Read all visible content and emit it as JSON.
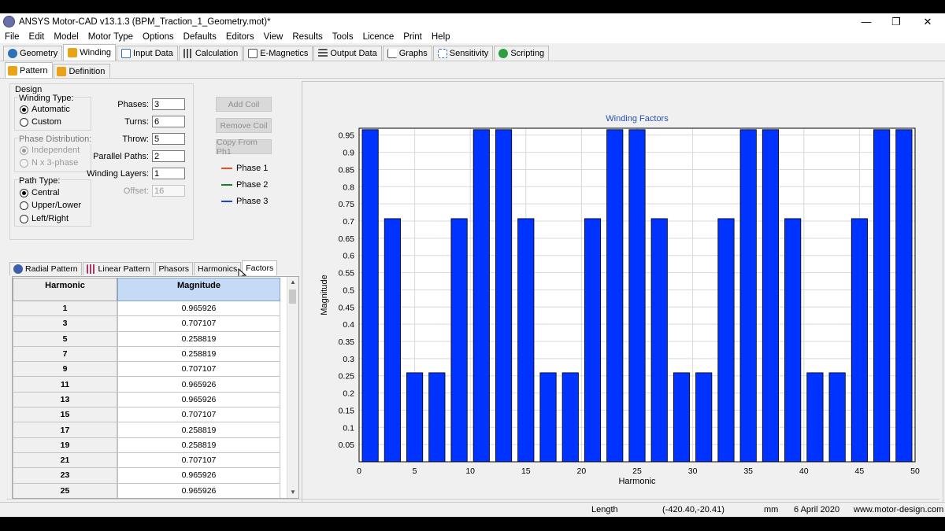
{
  "title": "ANSYS Motor-CAD v13.1.3 (BPM_Traction_1_Geometry.mot)*",
  "window_controls": {
    "minimize": "—",
    "restore": "❐",
    "close": "✕"
  },
  "menu": [
    "File",
    "Edit",
    "Model",
    "Motor Type",
    "Options",
    "Defaults",
    "Editors",
    "View",
    "Results",
    "Tools",
    "Licence",
    "Print",
    "Help"
  ],
  "main_tabs": [
    {
      "label": "Geometry",
      "icon": "geometry-icon",
      "color": "#2e6fb8"
    },
    {
      "label": "Winding",
      "icon": "winding-icon",
      "color": "#e8a318"
    },
    {
      "label": "Input Data",
      "icon": "input-data-icon",
      "color": "#3b6fa8"
    },
    {
      "label": "Calculation",
      "icon": "calculation-icon",
      "color": "#555555"
    },
    {
      "label": "E-Magnetics",
      "icon": "emagnetics-icon",
      "color": "#555555"
    },
    {
      "label": "Output Data",
      "icon": "output-data-icon",
      "color": "#555555"
    },
    {
      "label": "Graphs",
      "icon": "graphs-icon",
      "color": "#c0392b"
    },
    {
      "label": "Sensitivity",
      "icon": "sensitivity-icon",
      "color": "#3b6fa8"
    },
    {
      "label": "Scripting",
      "icon": "scripting-icon",
      "color": "#2e9e3e"
    }
  ],
  "sub_tabs": [
    {
      "label": "Pattern"
    },
    {
      "label": "Definition"
    }
  ],
  "design": {
    "group_label": "Design",
    "winding_type": {
      "label": "Winding Type:",
      "options": [
        "Automatic",
        "Custom"
      ],
      "selected": 0
    },
    "phase_distribution": {
      "label": "Phase Distribution:",
      "options": [
        "Independent",
        "N x 3-phase"
      ],
      "selected": 0
    },
    "path_type": {
      "label": "Path Type:",
      "options": [
        "Central",
        "Upper/Lower",
        "Left/Right"
      ],
      "selected": 0
    },
    "fields": [
      {
        "label": "Phases:",
        "value": "3"
      },
      {
        "label": "Turns:",
        "value": "6"
      },
      {
        "label": "Throw:",
        "value": "5"
      },
      {
        "label": "Parallel Paths:",
        "value": "2"
      },
      {
        "label": "Winding Layers:",
        "value": "1"
      },
      {
        "label": "Offset:",
        "value": "16"
      }
    ]
  },
  "coil_buttons": [
    "Add Coil",
    "Remove Coil",
    "Copy From Ph1"
  ],
  "phase_legend": [
    {
      "label": "Phase 1",
      "color": "#e8501f"
    },
    {
      "label": "Phase 2",
      "color": "#1d7a2a"
    },
    {
      "label": "Phase 3",
      "color": "#1f3fe0"
    }
  ],
  "bottom_tabs": [
    "Radial Pattern",
    "Linear Pattern",
    "Phasors",
    "Harmonics",
    "Factors"
  ],
  "table": {
    "headers": [
      "Harmonic",
      "Magnitude"
    ],
    "rows": [
      [
        "1",
        "0.965926"
      ],
      [
        "3",
        "0.707107"
      ],
      [
        "5",
        "0.258819"
      ],
      [
        "7",
        "0.258819"
      ],
      [
        "9",
        "0.707107"
      ],
      [
        "11",
        "0.965926"
      ],
      [
        "13",
        "0.965926"
      ],
      [
        "15",
        "0.707107"
      ],
      [
        "17",
        "0.258819"
      ],
      [
        "19",
        "0.258819"
      ],
      [
        "21",
        "0.707107"
      ],
      [
        "23",
        "0.965926"
      ],
      [
        "25",
        "0.965926"
      ]
    ]
  },
  "status": {
    "field": "Length",
    "coords": "(-420.40,-20.41)",
    "unit": "mm",
    "date": "6 April 2020",
    "website": "www.motor-design.com"
  },
  "chart_data": {
    "type": "bar",
    "title": "Winding Factors",
    "xlabel": "Harmonic",
    "ylabel": "Magnitude",
    "x": [
      1,
      3,
      5,
      7,
      9,
      11,
      13,
      15,
      17,
      19,
      21,
      23,
      25,
      27,
      29,
      31,
      33,
      35,
      37,
      39,
      41,
      43,
      45,
      47,
      49
    ],
    "values": [
      0.965926,
      0.707107,
      0.258819,
      0.258819,
      0.707107,
      0.965926,
      0.965926,
      0.707107,
      0.258819,
      0.258819,
      0.707107,
      0.965926,
      0.965926,
      0.707107,
      0.258819,
      0.258819,
      0.707107,
      0.965926,
      0.965926,
      0.707107,
      0.258819,
      0.258819,
      0.707107,
      0.965926,
      0.965926
    ],
    "xlim": [
      0,
      50
    ],
    "ylim": [
      0,
      0.97
    ],
    "xticks": [
      0,
      5,
      10,
      15,
      20,
      25,
      30,
      35,
      40,
      45,
      50
    ],
    "yticks": [
      0.05,
      0.1,
      0.15,
      0.2,
      0.25,
      0.3,
      0.35,
      0.4,
      0.45,
      0.5,
      0.55,
      0.6,
      0.65,
      0.7,
      0.75,
      0.8,
      0.85,
      0.9,
      0.95
    ],
    "grid": true,
    "bar_color": "#0033ff",
    "title_color": "#2a4fb5"
  }
}
